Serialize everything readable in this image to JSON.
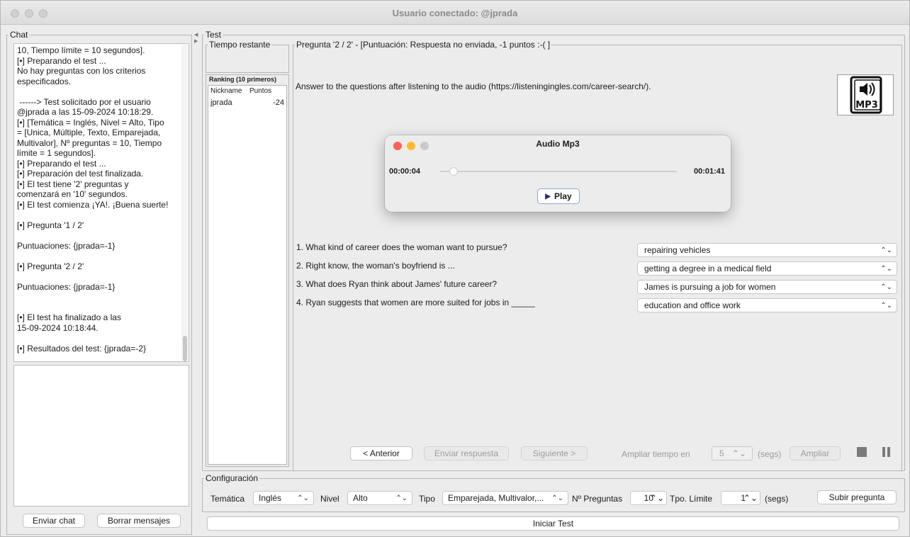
{
  "window": {
    "title": "Usuario conectado: @jprada"
  },
  "chat": {
    "group_label": "Chat",
    "log": [
      "10, Tiempo límite = 10 segundos].",
      "[•] Preparando el test ...",
      "No hay preguntas con los criterios",
      "especificados.",
      "",
      " ------> Test solicitado por el usuario",
      "@jprada a las 15-09-2024 10:18:29.",
      "[•] [Temática = Inglés, Nivel = Alto, Tipo",
      "= [Unica, Múltiple, Texto, Emparejada,",
      "Multivalor], Nº preguntas = 10, Tiempo",
      "límite = 1 segundos].",
      "[•] Preparando el test ...",
      "[•] Preparación del test finalizada.",
      "[•] El test tiene '2' preguntas y",
      "comenzará en '10' segundos.",
      "[•] El test comienza ¡YA!. ¡Buena suerte!",
      "",
      "[•] Pregunta '1 / 2'",
      "",
      "Puntuaciones: {jprada=-1}",
      "",
      "[•] Pregunta '2 / 2'",
      "",
      "Puntuaciones: {jprada=-1}",
      "",
      "",
      "[•] El test ha finalizado a las",
      "15-09-2024 10:18:44.",
      "",
      "[•] Resultados del test: {jprada=-2}"
    ],
    "send_label": "Enviar chat",
    "clear_label": "Borrar mensajes"
  },
  "test": {
    "group_label": "Test",
    "time_label": "Tiempo restante",
    "ranking": {
      "title": "Ranking (10 primeros)",
      "columns": [
        "Nickname",
        "Puntos"
      ],
      "rows": [
        {
          "nickname": "jprada",
          "points": "-24"
        }
      ]
    },
    "question_header": "Pregunta '2 / 2' - [Puntuación: Respuesta no enviada, -1 puntos :-( ]",
    "instruction": "Answer to the questions after listening to the audio (https://listeningingles.com/career-search/).",
    "mp3_icon_text": "MP3",
    "questions": [
      {
        "text": "1. What kind of career does the woman want to pursue?",
        "answer": "repairing vehicles"
      },
      {
        "text": "2. Right know, the woman's boyfriend is ...",
        "answer": "getting a degree in a medical field"
      },
      {
        "text": "3. What does Ryan think about James' future career?",
        "answer": "James is pursuing a job for women"
      },
      {
        "text": "4. Ryan suggests that women are more suited for jobs in _____",
        "answer": "education and office work"
      }
    ],
    "nav": {
      "prev": "< Anterior",
      "send": "Enviar respuesta",
      "next": "Siguiente >",
      "extend_label": "Ampliar tiempo en",
      "extend_value": "5",
      "extend_unit": "(segs)",
      "extend_button": "Ampliar"
    }
  },
  "audio": {
    "title": "Audio Mp3",
    "current_time": "00:00:04",
    "total_time": "00:01:41",
    "play_label": "Play",
    "progress": 0.04
  },
  "config": {
    "group_label": "Configuración",
    "tematica_label": "Temática",
    "tematica_value": "Inglés",
    "nivel_label": "Nivel",
    "nivel_value": "Alto",
    "tipo_label": "Tipo",
    "tipo_value": "Emparejada, Multivalor,...",
    "npreg_label": "Nº Preguntas",
    "npreg_value": "10",
    "tpo_label": "Tpo. Límite",
    "tpo_value": "1",
    "tpo_unit": "(segs)",
    "upload_label": "Subir pregunta",
    "start_label": "Iniciar Test"
  },
  "colors": {
    "close": "#ff5f57",
    "minimize": "#febc2e",
    "zoom": "#c9c9c9",
    "play_icon": "#2a2a7a"
  }
}
